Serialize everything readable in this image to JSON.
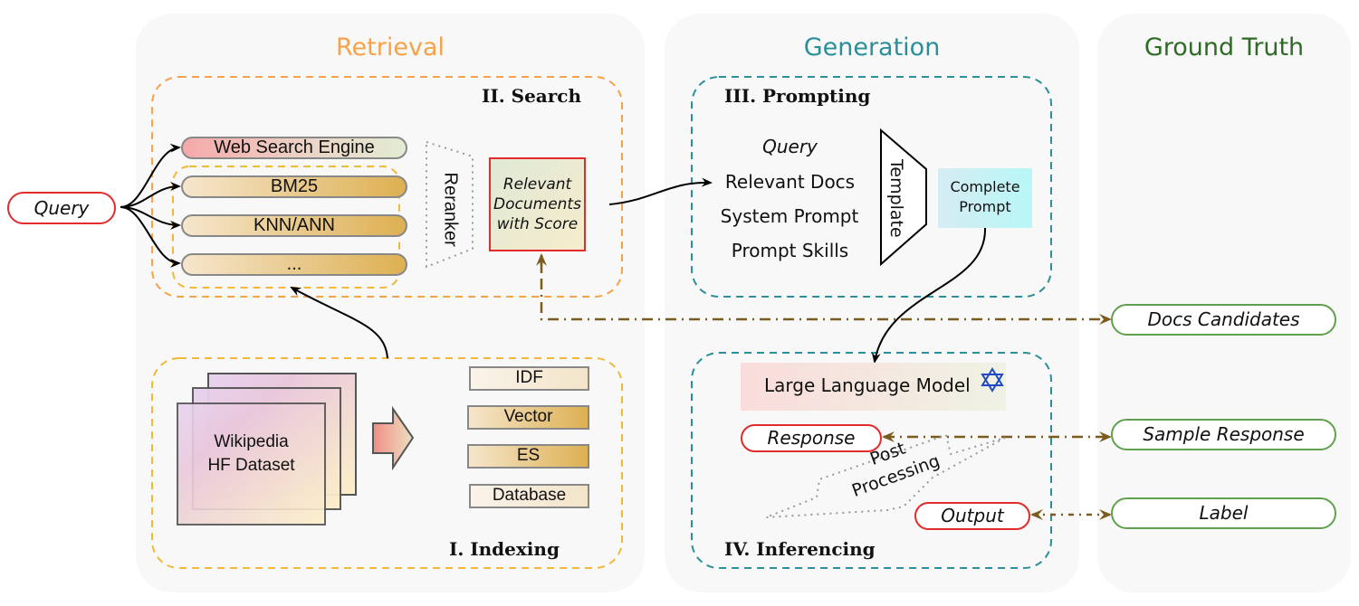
{
  "external": {
    "query_label": "Query"
  },
  "retrieval": {
    "title": "Retrieval",
    "title_color": "#f7a248",
    "search": {
      "title": "II. Search",
      "engines": [
        "Web Search Engine",
        "BM25",
        "KNN/ANN",
        "..."
      ],
      "reranker_label": "Reranker",
      "relevant_docs_label": "Relevant Documents with Score"
    },
    "indexing": {
      "title": "I. Indexing",
      "dataset_line1": "Wikipedia",
      "dataset_line2": "HF Dataset",
      "index_types": [
        "IDF",
        "Vector",
        "ES",
        "Database"
      ]
    }
  },
  "generation": {
    "title": "Generation",
    "title_color": "#2a8f9a",
    "prompting": {
      "title": "III. Prompting",
      "inputs": [
        "Query",
        "Relevant Docs",
        "System Prompt",
        "Prompt Skills"
      ],
      "template_label": "Template",
      "complete_prompt_line1": "Complete",
      "complete_prompt_line2": "Prompt"
    },
    "inferencing": {
      "title": "IV. Inferencing",
      "llm_label": "Large Language Model",
      "llm_icon": "star-of-david-icon",
      "response_label": "Response",
      "post_processing_line1": "Post",
      "post_processing_line2": "Processing",
      "output_label": "Output"
    }
  },
  "ground_truth": {
    "title": "Ground Truth",
    "title_color": "#2e6b24",
    "items": [
      "Docs Candidates",
      "Sample Response",
      "Label"
    ]
  },
  "colors": {
    "retrieval_dash": "#f7a248",
    "inner_dash": "#f0b93a",
    "generation_dash": "#2a8f9a",
    "gt_arrow": "#7a5c1e",
    "red_border": "#e32b2b",
    "green_border": "#5fa04e"
  }
}
